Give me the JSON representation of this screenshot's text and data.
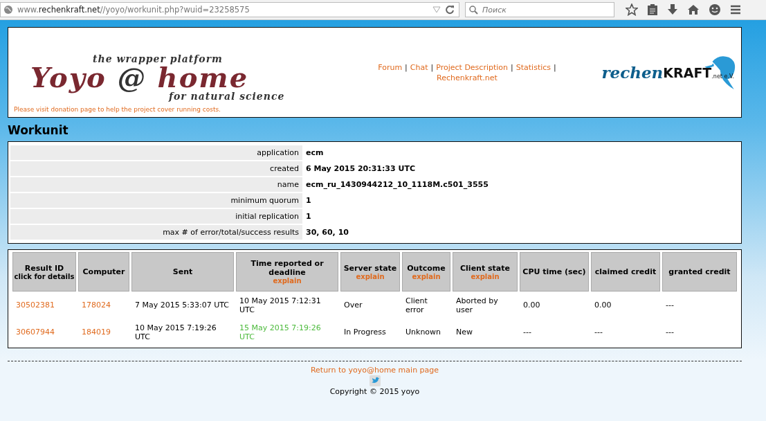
{
  "browser": {
    "url": "www.**rechenkraft.net**//yoyo/workunit.php?wuid=23258575",
    "search": {
      "placeholder": "Поиск"
    }
  },
  "header": {
    "logo": {
      "top": "the wrapper platform",
      "main_left": "Yoyo",
      "at": "@",
      "main_right": "home",
      "bottom": "for natural science"
    },
    "donation_note": "Please visit donation page to help the project cover running costs.",
    "nav": [
      "Forum",
      "Chat",
      "Project Description",
      "Statistics",
      "Rechenkraft.net"
    ],
    "nav_separator": "|",
    "partner_logo": {
      "word": "rechen",
      "caps": "KRAFT",
      "suffix": ".net e.V."
    }
  },
  "title": "Workunit",
  "info": [
    {
      "label": "application",
      "value": "ecm"
    },
    {
      "label": "created",
      "value": "6 May 2015 20:31:33 UTC"
    },
    {
      "label": "name",
      "value": "ecm_ru_1430944212_10_1118M.c501_3555"
    },
    {
      "label": "minimum quorum",
      "value": "1"
    },
    {
      "label": "initial replication",
      "value": "1"
    },
    {
      "label": "max # of error/total/success results",
      "value": "30, 60, 10"
    }
  ],
  "results": {
    "columns": [
      {
        "label": "Result ID",
        "sub": "click for details"
      },
      {
        "label": "Computer"
      },
      {
        "label": "Sent"
      },
      {
        "label": "Time reported or deadline",
        "link": "explain"
      },
      {
        "label": "Server state",
        "link": "explain"
      },
      {
        "label": "Outcome",
        "link": "explain"
      },
      {
        "label": "Client state",
        "link": "explain"
      },
      {
        "label": "CPU time (sec)"
      },
      {
        "label": "claimed credit"
      },
      {
        "label": "granted credit"
      }
    ],
    "rows": [
      {
        "result_id": "30502381",
        "computer": "178024",
        "sent": "7 May 2015 5:33:07 UTC",
        "time": "10 May 2015 7:12:31 UTC",
        "deadline_pending": false,
        "server_state": "Over",
        "outcome": "Client error",
        "client_state": "Aborted by user",
        "cpu_time": "0.00",
        "claimed": "0.00",
        "granted": "---"
      },
      {
        "result_id": "30607944",
        "computer": "184019",
        "sent": "10 May 2015 7:19:26 UTC",
        "time": "15 May 2015 7:19:26 UTC",
        "deadline_pending": true,
        "server_state": "In Progress",
        "outcome": "Unknown",
        "client_state": "New",
        "cpu_time": "---",
        "claimed": "---",
        "granted": "---"
      }
    ]
  },
  "footer": {
    "link": "Return to yoyo@home main page",
    "copyright": "Copyright © 2015 yoyo"
  }
}
